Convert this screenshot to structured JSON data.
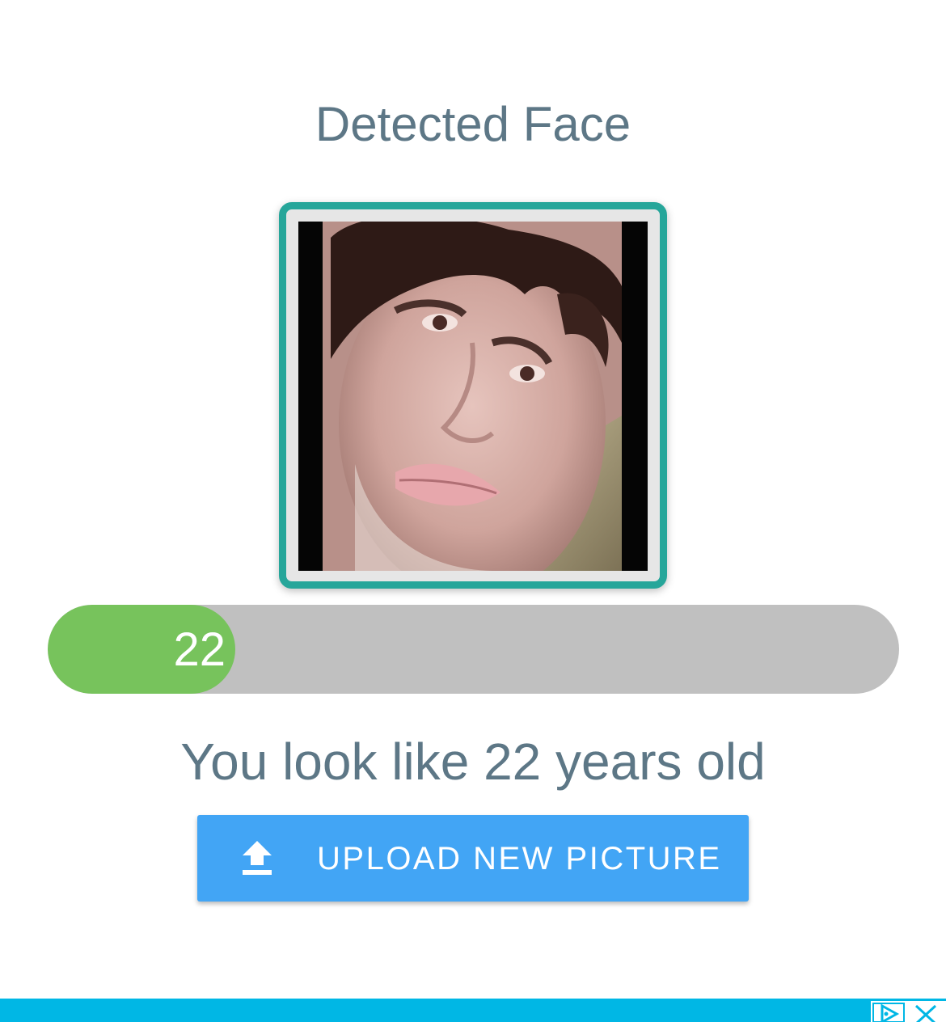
{
  "header": {
    "title": "Detected Face"
  },
  "face": {
    "image": "detected-face-photo",
    "frame_color": "#26a69a"
  },
  "age_bar": {
    "value_label": "22",
    "fill_fraction": 0.22,
    "fill_color": "#77c35c",
    "track_color": "#c0c0c0"
  },
  "result": {
    "text": "You look like 22 years old"
  },
  "upload": {
    "icon": "upload-icon",
    "label": "UPLOAD NEW PICTURE",
    "color": "#42a5f5"
  },
  "ad": {
    "bar_color": "#00b7e5",
    "info_icon": "ad-choices-icon",
    "close_icon": "close-icon"
  }
}
